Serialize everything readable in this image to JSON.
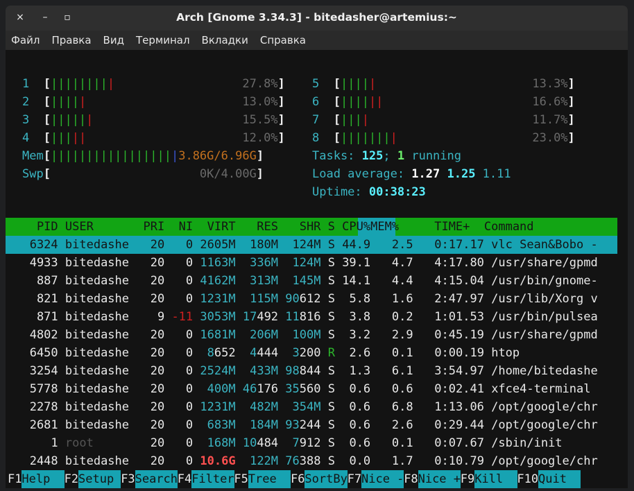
{
  "window": {
    "title": "Arch [Gnome 3.34.3] - bitedasher@artemius:~",
    "close": "×",
    "minimize": "–",
    "maximize": "▫"
  },
  "menubar": [
    "Файл",
    "Правка",
    "Вид",
    "Терминал",
    "Вкладки",
    "Справка"
  ],
  "cpus": [
    {
      "id": "1",
      "green": "||||||||",
      "red": "|",
      "pct": "27.8%"
    },
    {
      "id": "2",
      "green": "||||",
      "red": "|",
      "pct": "13.0%"
    },
    {
      "id": "3",
      "green": "|||||",
      "red": "|",
      "pct": "15.5%"
    },
    {
      "id": "4",
      "green": "|||",
      "red": "||",
      "pct": "12.0%"
    },
    {
      "id": "5",
      "green": "||||",
      "red": "|",
      "pct": "13.3%"
    },
    {
      "id": "6",
      "green": "||||",
      "red": "||",
      "pct": "16.6%"
    },
    {
      "id": "7",
      "green": "|||",
      "red": "|",
      "pct": "11.7%"
    },
    {
      "id": "8",
      "green": "|||||||",
      "red": "|",
      "pct": "23.0%"
    }
  ],
  "mem": {
    "label": "Mem",
    "bars_green": "|||||||||||||||||",
    "bars_blue": "|",
    "value": "3.86G/6.96G"
  },
  "swp": {
    "label": "Swp",
    "value": "0K/4.00G"
  },
  "tasks": {
    "label": "Tasks: ",
    "count": "125",
    "sep": "; ",
    "running": "1",
    "running_label": " running"
  },
  "load": {
    "label": "Load average: ",
    "l1": "1.27",
    "l5": "1.25",
    "l15": "1.11"
  },
  "uptime": {
    "label": "Uptime: ",
    "value": "00:38:23"
  },
  "header": [
    "PID",
    "USER",
    "PRI",
    "NI",
    "VIRT",
    "RES",
    "SHR",
    "S",
    "CPU%",
    "MEM%",
    "TIME+",
    "Command"
  ],
  "processes": [
    {
      "pid": "6324",
      "user": "bitedashe",
      "pri": "20",
      "ni": "0",
      "virt": "2605M",
      "res": "180M",
      "shr": "124M",
      "s": "S",
      "cpu": "44.9",
      "mem": "2.5",
      "time": "0:17.17",
      "cmd": "vlc Sean&Bobo -"
    },
    {
      "pid": "4933",
      "user": "bitedashe",
      "pri": "20",
      "ni": "0",
      "virt": "1163M",
      "res": "336M",
      "shr": "124M",
      "s": "S",
      "cpu": "39.1",
      "mem": "4.7",
      "time": "4:17.80",
      "cmd": "/usr/share/gpmd"
    },
    {
      "pid": "887",
      "user": "bitedashe",
      "pri": "20",
      "ni": "0",
      "virt": "4162M",
      "res": "313M",
      "shr": "145M",
      "s": "S",
      "cpu": "14.1",
      "mem": "4.4",
      "time": "4:15.04",
      "cmd": "/usr/bin/gnome-"
    },
    {
      "pid": "821",
      "user": "bitedashe",
      "pri": "20",
      "ni": "0",
      "virt": "1231M",
      "res": "115M",
      "shr": "90612",
      "s": "S",
      "cpu": "5.8",
      "mem": "1.6",
      "time": "2:47.97",
      "cmd": "/usr/lib/Xorg v"
    },
    {
      "pid": "871",
      "user": "bitedashe",
      "pri": "9",
      "ni": "-11",
      "virt": "3053M",
      "res": "17492",
      "shr": "11816",
      "s": "S",
      "cpu": "3.8",
      "mem": "0.2",
      "time": "1:01.53",
      "cmd": "/usr/bin/pulsea"
    },
    {
      "pid": "4802",
      "user": "bitedashe",
      "pri": "20",
      "ni": "0",
      "virt": "1681M",
      "res": "206M",
      "shr": "100M",
      "s": "S",
      "cpu": "3.2",
      "mem": "2.9",
      "time": "0:45.19",
      "cmd": "/usr/share/gpmd"
    },
    {
      "pid": "6450",
      "user": "bitedashe",
      "pri": "20",
      "ni": "0",
      "virt": "8652",
      "res": "4444",
      "shr": "3200",
      "s": "R",
      "cpu": "2.6",
      "mem": "0.1",
      "time": "0:00.19",
      "cmd": "htop"
    },
    {
      "pid": "3254",
      "user": "bitedashe",
      "pri": "20",
      "ni": "0",
      "virt": "2524M",
      "res": "433M",
      "shr": "98844",
      "s": "S",
      "cpu": "1.3",
      "mem": "6.1",
      "time": "3:54.97",
      "cmd": "/home/bitedashe"
    },
    {
      "pid": "5778",
      "user": "bitedashe",
      "pri": "20",
      "ni": "0",
      "virt": "400M",
      "res": "46176",
      "shr": "35560",
      "s": "S",
      "cpu": "0.6",
      "mem": "0.6",
      "time": "0:02.41",
      "cmd": "xfce4-terminal"
    },
    {
      "pid": "2278",
      "user": "bitedashe",
      "pri": "20",
      "ni": "0",
      "virt": "1231M",
      "res": "482M",
      "shr": "354M",
      "s": "S",
      "cpu": "0.6",
      "mem": "6.8",
      "time": "1:13.06",
      "cmd": "/opt/google/chr"
    },
    {
      "pid": "2681",
      "user": "bitedashe",
      "pri": "20",
      "ni": "0",
      "virt": "683M",
      "res": "184M",
      "shr": "93244",
      "s": "S",
      "cpu": "0.6",
      "mem": "2.6",
      "time": "0:29.44",
      "cmd": "/opt/google/chr"
    },
    {
      "pid": "1",
      "user": "root",
      "pri": "20",
      "ni": "0",
      "virt": "168M",
      "res": "10484",
      "shr": "7912",
      "s": "S",
      "cpu": "0.6",
      "mem": "0.1",
      "time": "0:07.67",
      "cmd": "/sbin/init"
    },
    {
      "pid": "2448",
      "user": "bitedashe",
      "pri": "20",
      "ni": "0",
      "virt": "10.6G",
      "res": "122M",
      "shr": "76388",
      "s": "S",
      "cpu": "0.0",
      "mem": "1.7",
      "time": "0:10.79",
      "cmd": "/opt/google/chr"
    }
  ],
  "fkeys": [
    {
      "key": "F1",
      "label": "Help  "
    },
    {
      "key": "F2",
      "label": "Setup "
    },
    {
      "key": "F3",
      "label": "Search"
    },
    {
      "key": "F4",
      "label": "Filter"
    },
    {
      "key": "F5",
      "label": "Tree  "
    },
    {
      "key": "F6",
      "label": "SortBy"
    },
    {
      "key": "F7",
      "label": "Nice -"
    },
    {
      "key": "F8",
      "label": "Nice +"
    },
    {
      "key": "F9",
      "label": "Kill  "
    },
    {
      "key": "F10",
      "label": "Quit  "
    }
  ],
  "colors": {
    "header_bg": "#12a514",
    "selection_bg": "#17a3b2",
    "cyan": "#3bb5c3",
    "terminal_bg": "#131313"
  }
}
